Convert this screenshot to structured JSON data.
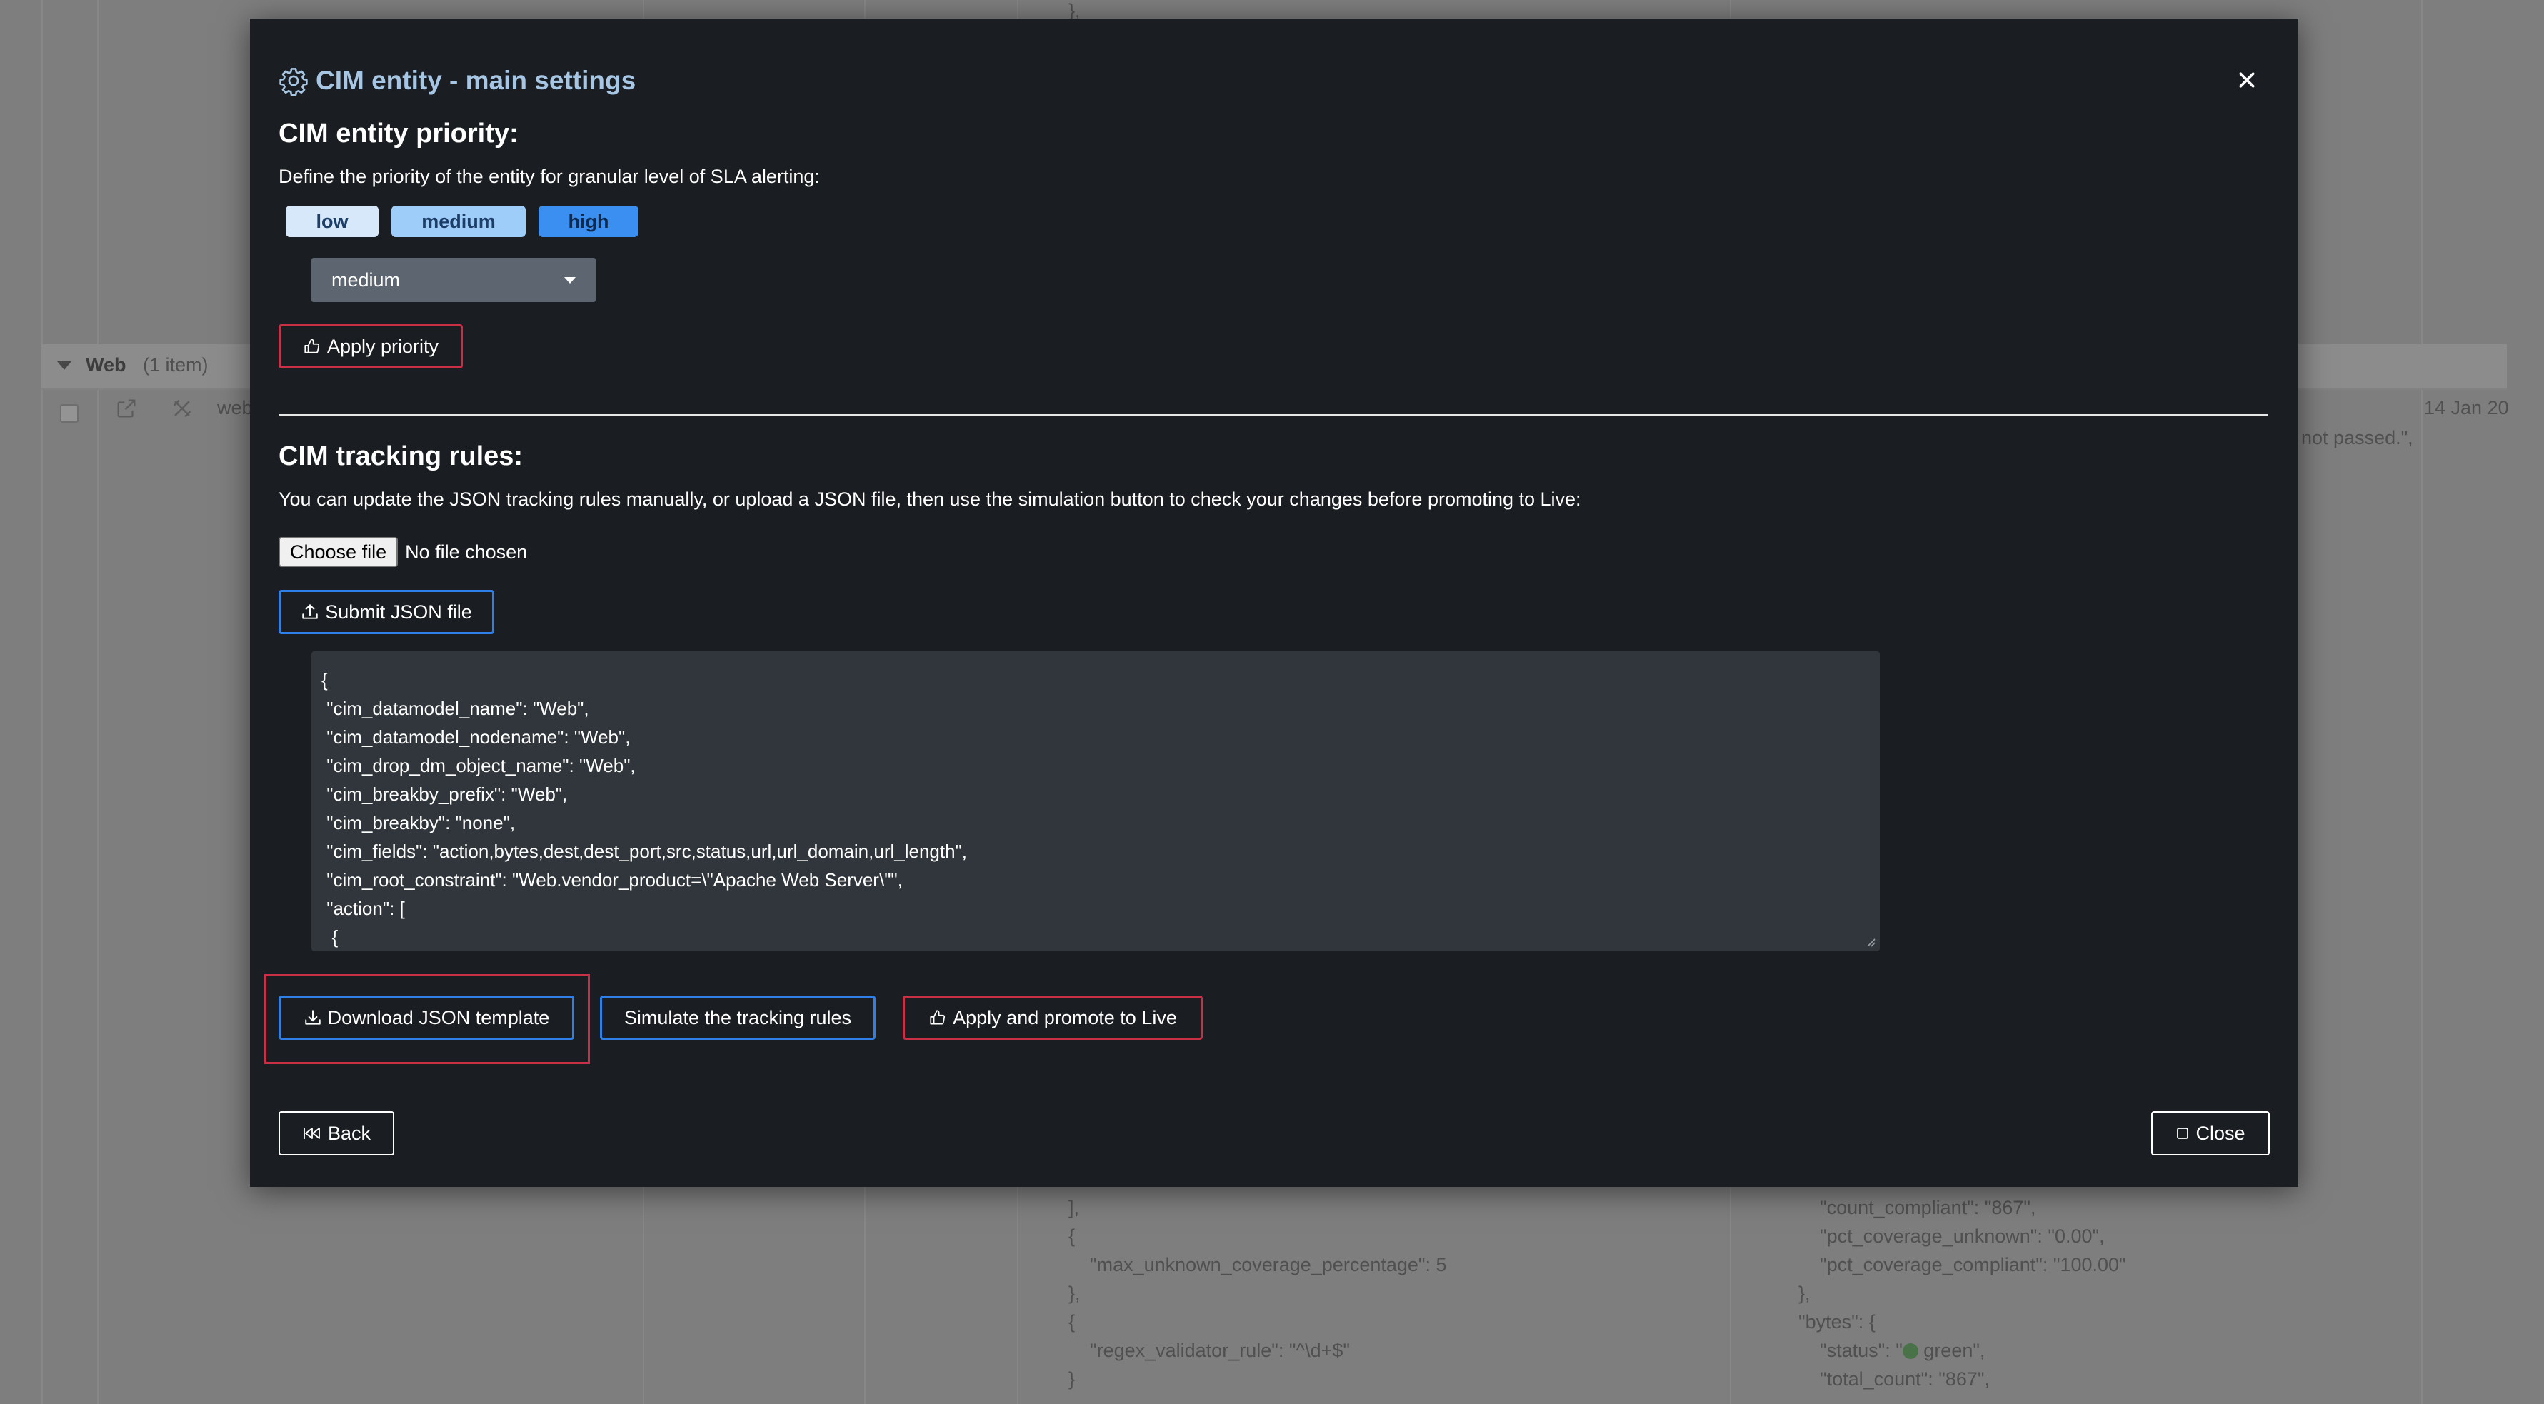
{
  "background": {
    "group": {
      "title": "Web",
      "count": "(1 item)"
    },
    "row": {
      "name_fragment": "web",
      "date_fragment": "14 Jan 20",
      "message_fragment": "not passed.\","
    },
    "json_left": [
      "],",
      "},",
      "{",
      "\"max_unknown_coverage_percentage\": 5",
      "},",
      "{",
      "\"regex_validator_rule\": \"^\\d+$\"",
      "}"
    ],
    "json_right": [
      "\"count_compliant\": \"867\",",
      "\"pct_coverage_unknown\": \"0.00\",",
      "\"pct_coverage_compliant\": \"100.00\"",
      "},",
      "\"bytes\": {",
      "\"status\": \"",
      " green\",",
      "\"total_count\": \"867\","
    ]
  },
  "modal": {
    "title": "CIM entity - main settings",
    "priority": {
      "heading": "CIM entity priority:",
      "description": "Define the priority of the entity for granular level of SLA alerting:",
      "pills": {
        "low": "low",
        "medium": "medium",
        "high": "high"
      },
      "selected": "medium",
      "apply_label": "Apply priority"
    },
    "tracking": {
      "heading": "CIM tracking rules:",
      "description": "You can update the JSON tracking rules manually, or upload a JSON file, then use the simulation button to check your changes before promoting to Live:",
      "choose_file_label": "Choose file",
      "no_file_label": "No file chosen",
      "submit_label": "Submit JSON file",
      "json_lines": [
        "{",
        " \"cim_datamodel_name\": \"Web\",",
        " \"cim_datamodel_nodename\": \"Web\",",
        " \"cim_drop_dm_object_name\": \"Web\",",
        " \"cim_breakby_prefix\": \"Web\",",
        " \"cim_breakby\": \"none\",",
        " \"cim_fields\": \"action,bytes,dest,dest_port,src,status,url,url_domain,url_length\",",
        " \"cim_root_constraint\": \"Web.vendor_product=\\\"Apache Web Server\\\"\",",
        " \"action\": [",
        "  {"
      ],
      "download_label": "Download JSON template",
      "simulate_label": "Simulate the tracking rules",
      "promote_label": "Apply and promote to Live"
    },
    "footer": {
      "back_label": "Back",
      "close_label": "Close"
    }
  }
}
